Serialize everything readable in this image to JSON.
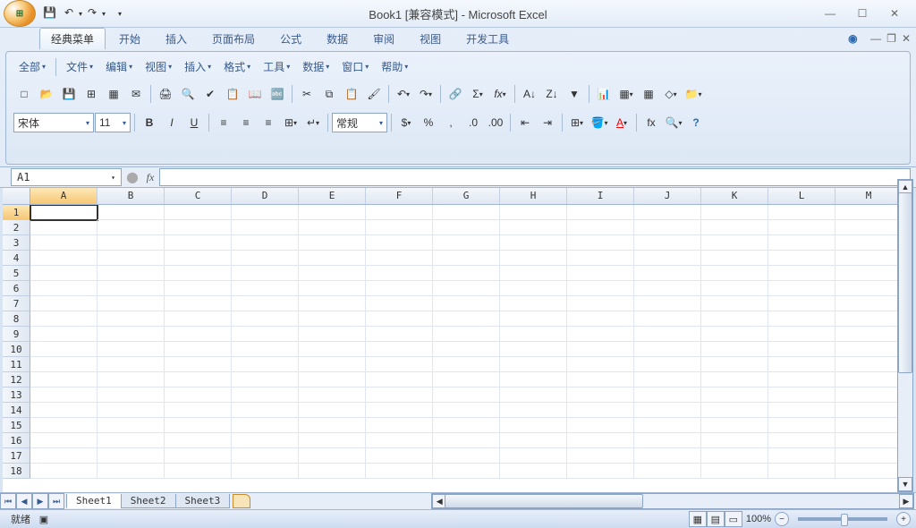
{
  "title": "Book1  [兼容模式] - Microsoft Excel",
  "qat": {
    "save": "💾",
    "undo": "↶",
    "redo": "↷"
  },
  "tabs": [
    "经典菜单",
    "开始",
    "插入",
    "页面布局",
    "公式",
    "数据",
    "审阅",
    "视图",
    "开发工具"
  ],
  "active_tab": 0,
  "classic_menu": [
    "全部",
    "文件",
    "编辑",
    "视图",
    "插入",
    "格式",
    "工具",
    "数据",
    "窗口",
    "帮助"
  ],
  "font": {
    "name": "宋体",
    "size": "11"
  },
  "number_format": "常规",
  "namebox": "A1",
  "formula": "",
  "fx_label": "fx",
  "columns": [
    "A",
    "B",
    "C",
    "D",
    "E",
    "F",
    "G",
    "H",
    "I",
    "J",
    "K",
    "L",
    "M"
  ],
  "rows": [
    "1",
    "2",
    "3",
    "4",
    "5",
    "6",
    "7",
    "8",
    "9",
    "10",
    "11",
    "12",
    "13",
    "14",
    "15",
    "16",
    "17",
    "18"
  ],
  "active_cell": {
    "row": 0,
    "col": 0
  },
  "sheets": [
    "Sheet1",
    "Sheet2",
    "Sheet3"
  ],
  "active_sheet": 0,
  "status": {
    "ready": "就绪",
    "zoom": "100%"
  },
  "icons": {
    "new": "□",
    "open": "📂",
    "save": "💾",
    "excel": "⊞",
    "print_area": "▦",
    "mail": "✉",
    "print": "🖨",
    "preview": "🔍",
    "spell": "✔",
    "research": "📋",
    "cut": "✂",
    "copy": "⧉",
    "paste": "📋",
    "format_painter": "🖌",
    "undo": "↶",
    "redo": "↷",
    "link": "🔗",
    "sum": "Σ",
    "fx": "fx",
    "sort_asc": "A↓",
    "sort_desc": "Z↓",
    "chart": "📊",
    "pivot": "▦",
    "table": "▦",
    "shapes": "◇",
    "folder": "📁",
    "bold": "B",
    "italic": "I",
    "underline": "U",
    "align_l": "≡",
    "align_c": "≡",
    "align_r": "≡",
    "merge": "⊞",
    "indent_dec": "⇤",
    "indent_inc": "⇥",
    "currency": "$",
    "percent": "%",
    "comma": ",",
    "dec_inc": ".0",
    "dec_dec": ".00",
    "borders": "⊞",
    "fill": "🪣",
    "font_color": "A",
    "insert_fn": "fx",
    "zoom": "🔍",
    "help": "?"
  }
}
